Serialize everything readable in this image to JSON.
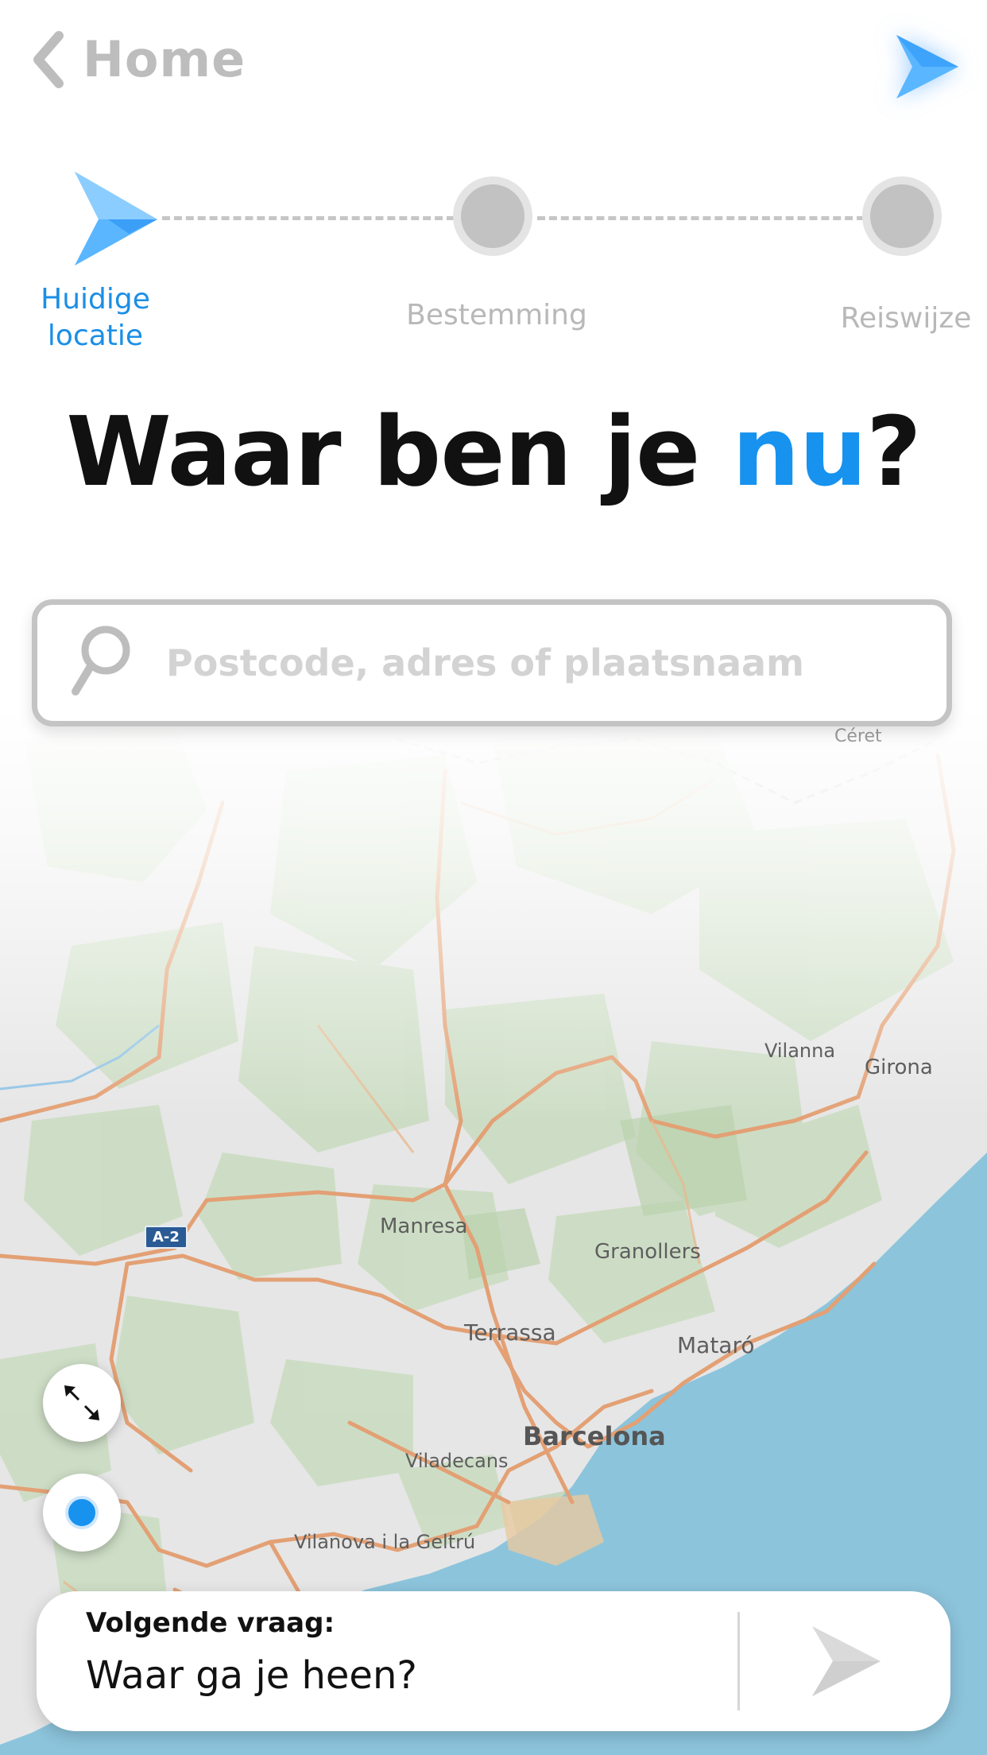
{
  "header": {
    "back_label": "Home",
    "back_icon": "chevron-left-icon",
    "logo_icon": "brand-arrow-icon"
  },
  "steps": [
    {
      "label": "Huidige\nlocatie",
      "state": "active"
    },
    {
      "label": "Bestemming",
      "state": "pending"
    },
    {
      "label": "Reiswijze",
      "state": "pending"
    }
  ],
  "title": {
    "prefix": "Waar ben je ",
    "accent": "nu",
    "suffix": "?"
  },
  "search": {
    "placeholder": "Postcode, adres of plaatsnaam",
    "icon": "search-icon"
  },
  "map": {
    "labels": {
      "ceret": "Céret",
      "vilanna": "Vilanna",
      "girona": "Girona",
      "manresa": "Manresa",
      "granollers": "Granollers",
      "terrassa": "Terrassa",
      "mataro": "Mataró",
      "barcelona": "Barcelona",
      "viladecans": "Viladecans",
      "vilanova": "Vilanova i la Geltrú",
      "a2": "A-2"
    }
  },
  "controls": {
    "expand_icon": "expand-diagonal-icon",
    "locate_icon": "current-location-icon"
  },
  "next": {
    "kicker": "Volgende vraag:",
    "question": "Waar ga je heen?",
    "go_icon": "next-arrow-icon"
  },
  "colors": {
    "accent": "#1792ef",
    "accent_light": "#5ab6ff",
    "sea": "#8cc4dc",
    "land": "#e6e6e6",
    "road": "#e3a074",
    "forest": "#c9dcc0"
  }
}
